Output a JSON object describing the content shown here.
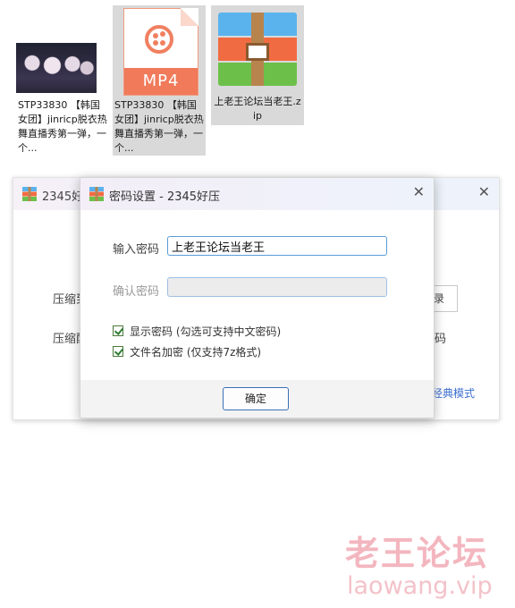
{
  "files": [
    {
      "caption": "STP33830 【韩国女团】jinricp脱衣热舞直播秀第一弹，一个...",
      "selected": false,
      "kind": "video-thumbnail"
    },
    {
      "caption": "STP33830 【韩国女团】jinricp脱衣热舞直播秀第一弹，一个...",
      "selected": true,
      "kind": "mp4-icon",
      "badge": "MP4"
    },
    {
      "caption": "上老王论坛当老王.zip",
      "selected": true,
      "kind": "zip-icon"
    }
  ],
  "back_window": {
    "title": "2345好",
    "labels": [
      "压缩到",
      "压缩配"
    ],
    "button_fragment": "录",
    "right_fragment": "码",
    "link_fragment": "经典模式"
  },
  "dialog": {
    "title": "密码设置 - 2345好压",
    "password_label": "输入密码",
    "password_value": "上老王论坛当老王",
    "confirm_label": "确认密码",
    "confirm_value": "",
    "show_password_label": "显示密码 (勾选可支持中文密码)",
    "show_password_checked": true,
    "encrypt_names_label": "文件名加密 (仅支持7z格式)",
    "encrypt_names_checked": true,
    "ok_label": "确定"
  },
  "watermark": {
    "line1": "老王论坛",
    "line2": "laowang.vip"
  },
  "colors": {
    "accent": "#3b6fb6",
    "link": "#3c6fd0",
    "watermark": "#f3b6bf"
  }
}
